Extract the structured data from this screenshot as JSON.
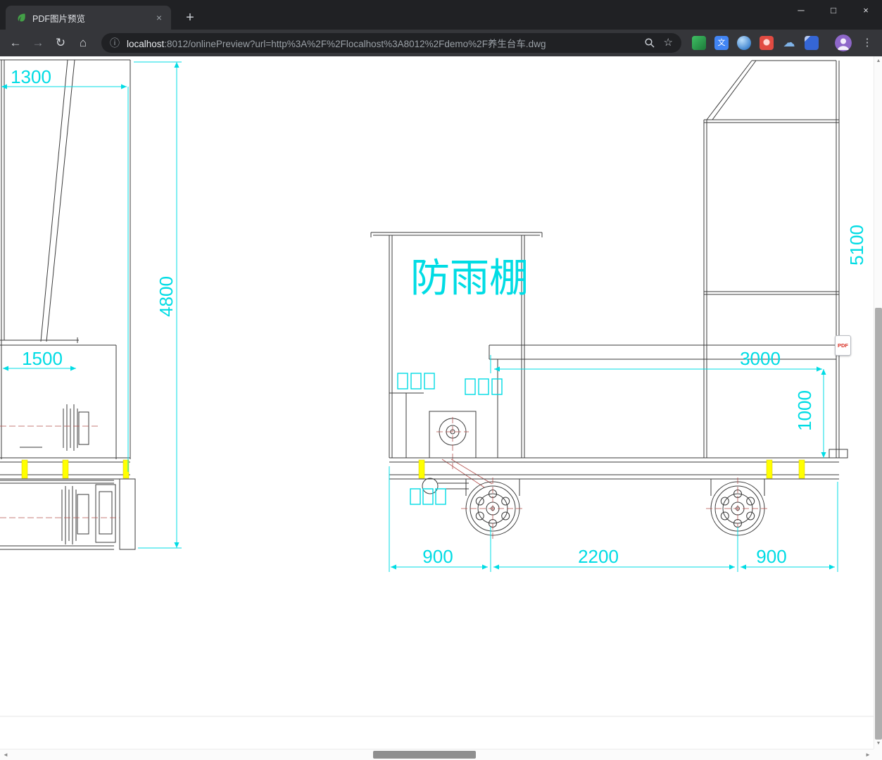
{
  "tab": {
    "title": "PDF图片预览"
  },
  "new_tab_label": "+",
  "window_controls": {
    "minimize": "─",
    "maximize": "□",
    "close": "×"
  },
  "icons": {
    "back": "←",
    "forward": "→",
    "reload": "↻",
    "home": "⌂",
    "info": "ⓘ",
    "star": "☆",
    "menu": "⋮",
    "tab_close": "×",
    "cloud": "☁",
    "translate_glyph": "文",
    "scroll_up": "▲",
    "scroll_down": "▼",
    "scroll_left": "◄",
    "scroll_right": "►"
  },
  "address_bar": {
    "host": "localhost",
    "rest": ":8012/onlinePreview?url=http%3A%2F%2Flocalhost%3A8012%2Fdemo%2F养生台车.dwg"
  },
  "drawing": {
    "shelter_label": "防雨棚",
    "dimensions": {
      "top_left_width": "1300",
      "left_height": "4800",
      "left_box_width": "1500",
      "right_height": "5100",
      "platform_length": "3000",
      "platform_height": "1000",
      "front_overhang": "900",
      "wheel_base": "2200",
      "rear_overhang": "900"
    }
  },
  "pdf_badge_label": "PDF",
  "colors": {
    "dimension_cyan": "#00dce4",
    "line_dark": "#3b3b3b",
    "highlight_yellow": "#ffff00",
    "centerline_red": "#b5524f",
    "chrome_dark": "#202124",
    "chrome_light": "#35363a",
    "url_secondary": "#9aa0a6",
    "pdf_red": "#d93025"
  }
}
